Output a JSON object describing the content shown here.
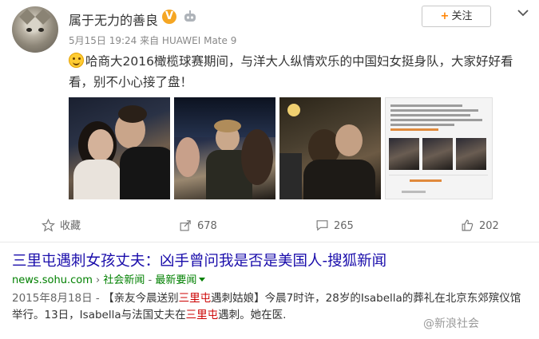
{
  "post": {
    "username": "属于无力的善良",
    "verified_badge": "V",
    "meta": "5月15日 19:24 来自 HUAWEI Mate 9",
    "follow_label": "关注",
    "text_line1": "哈商大2016橄榄球赛期间，与洋大人纵情欢乐的中国妇女挺身队，大家好好看",
    "text_line2": "看，别不小心接了盘！",
    "icons": [
      "avatar",
      "verified-icon",
      "member-icon",
      "chevron-down-icon",
      "smiley-icon"
    ]
  },
  "actions": {
    "favorite_label": "收藏",
    "share_count": "678",
    "comment_count": "265",
    "like_count": "202"
  },
  "search_result": {
    "title": "三里屯遇刺女孩丈夫：凶手曾问我是否是美国人-搜狐新闻",
    "url_domain": "news.sohu.com",
    "url_sep": " › ",
    "url_section": "社会新闻",
    "url_sep2": " - ",
    "url_latest": "最新要闻",
    "date": "2015年8月18日 - ",
    "desc_1": "【亲友今晨送别",
    "desc_hl1": "三里屯",
    "desc_2": "遇刺姑娘】今晨7时许，28岁的Isabella的葬礼在北京东郊殡仪馆",
    "desc_3": "举行。13日，Isabella与法国丈夫在",
    "desc_hl2": "三里屯",
    "desc_4": "遇刺。她在医."
  },
  "watermark": "@新浪社会",
  "colors": {
    "accent_orange": "#ff8200",
    "link_blue": "#1a0dab",
    "url_green": "#008000",
    "highlight_red": "#cc0000"
  }
}
